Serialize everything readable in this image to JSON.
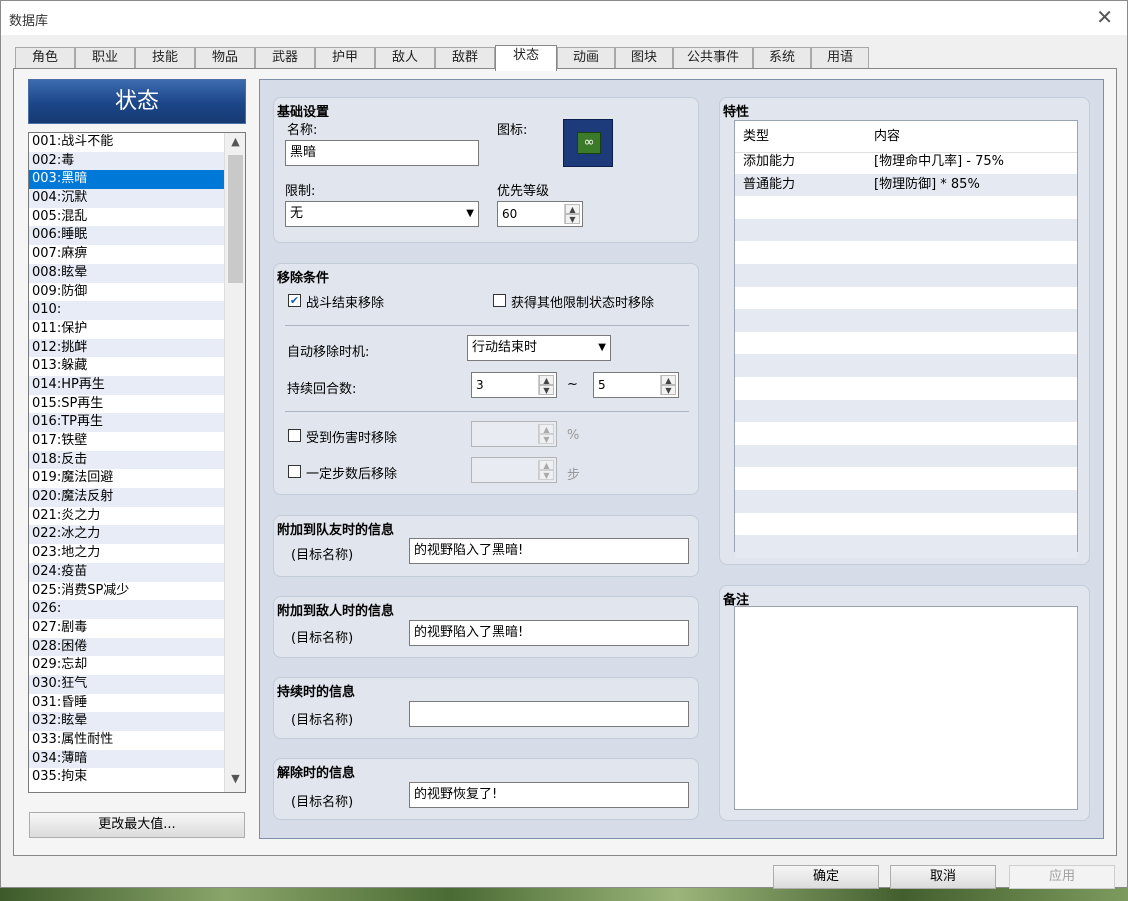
{
  "window": {
    "title": "数据库"
  },
  "tabs": [
    "角色",
    "职业",
    "技能",
    "物品",
    "武器",
    "护甲",
    "敌人",
    "敌群",
    "状态",
    "动画",
    "图块",
    "公共事件",
    "系统",
    "用语"
  ],
  "active_tab": "状态",
  "sidebar": {
    "header": "状态",
    "items": [
      "001:战斗不能",
      "002:毒",
      "003:黑暗",
      "004:沉默",
      "005:混乱",
      "006:睡眠",
      "007:麻痹",
      "008:眩晕",
      "009:防御",
      "010:",
      "011:保护",
      "012:挑衅",
      "013:躲藏",
      "014:HP再生",
      "015:SP再生",
      "016:TP再生",
      "017:铁壁",
      "018:反击",
      "019:魔法回避",
      "020:魔法反射",
      "021:炎之力",
      "022:冰之力",
      "023:地之力",
      "024:疫苗",
      "025:消费SP减少",
      "026:",
      "027:剧毒",
      "028:困倦",
      "029:忘却",
      "030:狂气",
      "031:昏睡",
      "032:眩晕",
      "033:属性耐性",
      "034:薄暗",
      "035:拘束"
    ],
    "selected": "003:黑暗",
    "change_max_button": "更改最大值..."
  },
  "basic": {
    "title": "基础设置",
    "name_label": "名称:",
    "name_value": "黑暗",
    "icon_label": "图标:",
    "restriction_label": "限制:",
    "restriction_value": "无",
    "priority_label": "优先等级",
    "priority_value": "60"
  },
  "removal": {
    "title": "移除条件",
    "remove_at_battle_end": "战斗结束移除",
    "remove_by_restriction": "获得其他限制状态时移除",
    "auto_removal_label": "自动移除时机:",
    "auto_removal_value": "行动结束时",
    "duration_label": "持续回合数:",
    "duration_min": "3",
    "tilde": "~",
    "duration_max": "5",
    "remove_by_damage": "受到伤害时移除",
    "percent_unit": "%",
    "remove_by_walking": "一定步数后移除",
    "steps_unit": "步"
  },
  "messages": [
    {
      "title": "附加到队友时的信息",
      "target": "(目标名称)",
      "value": "的视野陷入了黑暗!"
    },
    {
      "title": "附加到敌人时的信息",
      "target": "(目标名称)",
      "value": "的视野陷入了黑暗!"
    },
    {
      "title": "持续时的信息",
      "target": "(目标名称)",
      "value": ""
    },
    {
      "title": "解除时的信息",
      "target": "(目标名称)",
      "value": "的视野恢复了!"
    }
  ],
  "traits": {
    "title": "特性",
    "col_type": "类型",
    "col_content": "内容",
    "rows": [
      {
        "type": "添加能力",
        "content": "[物理命中几率] - 75%"
      },
      {
        "type": "普通能力",
        "content": "[物理防御] * 85%"
      }
    ]
  },
  "note": {
    "title": "备注",
    "value": ""
  },
  "footer": {
    "ok": "确定",
    "cancel": "取消",
    "apply": "应用"
  }
}
